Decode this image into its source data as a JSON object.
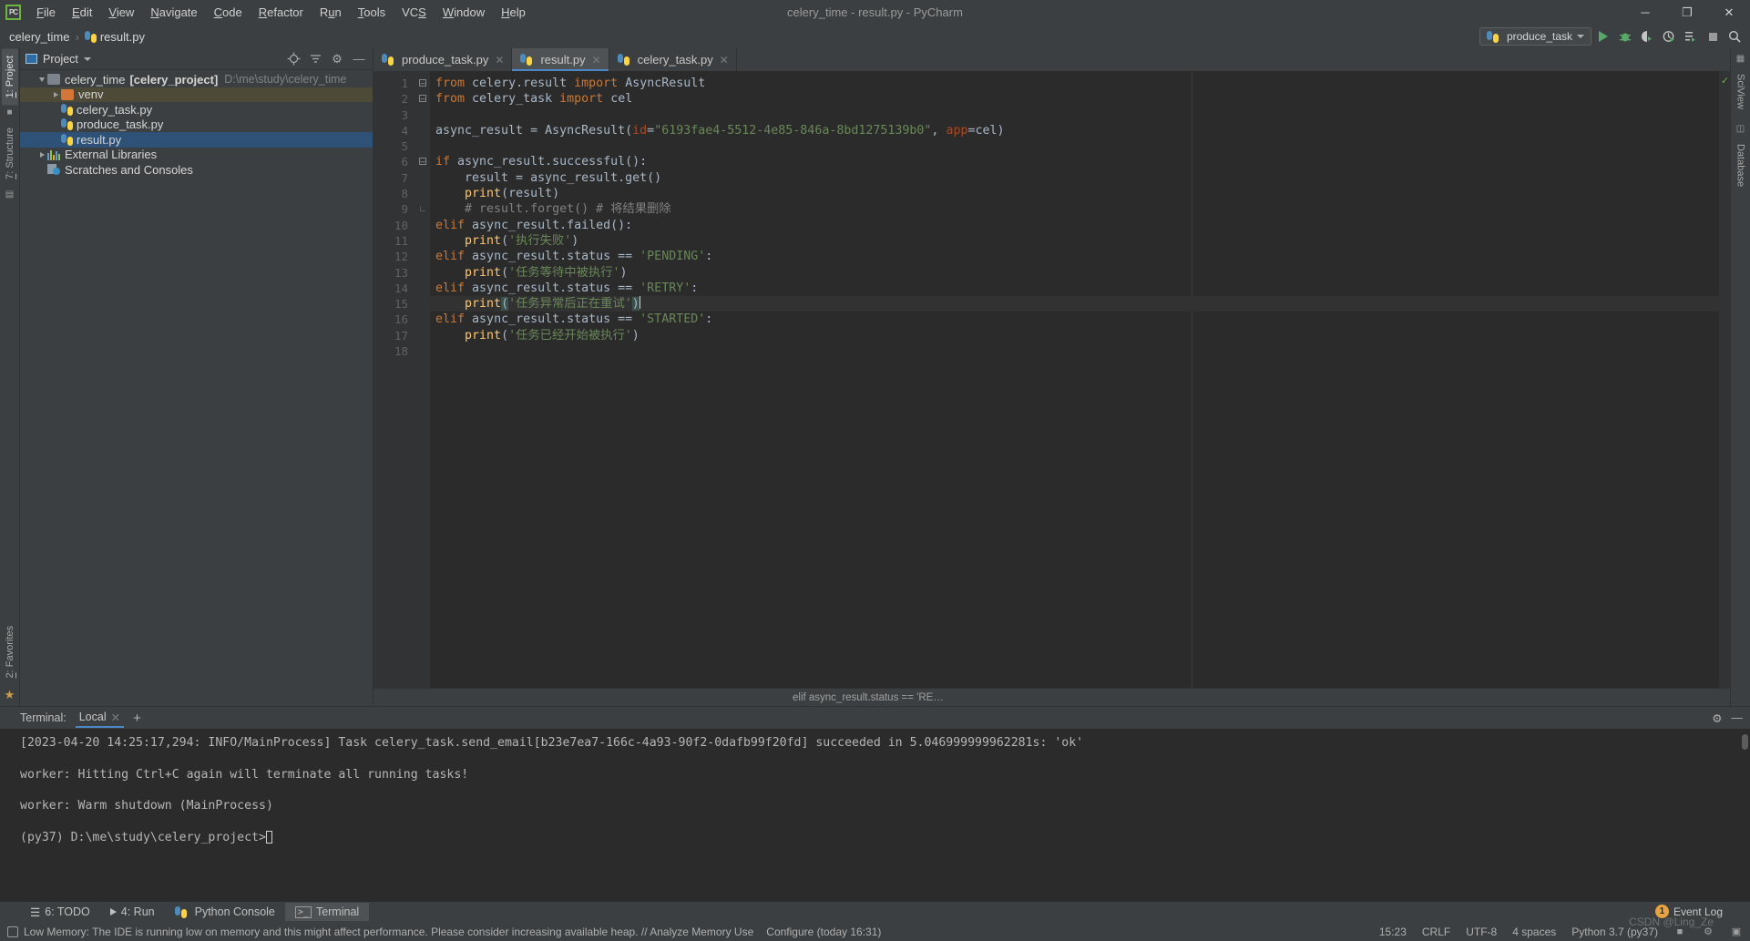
{
  "window": {
    "title": "celery_time - result.py - PyCharm",
    "logo": "pycharm-logo",
    "minimize": "─",
    "maximize": "❐",
    "close": "✕"
  },
  "menu": [
    {
      "label": "File"
    },
    {
      "label": "Edit"
    },
    {
      "label": "View"
    },
    {
      "label": "Navigate"
    },
    {
      "label": "Code"
    },
    {
      "label": "Refactor"
    },
    {
      "label": "Run"
    },
    {
      "label": "Tools"
    },
    {
      "label": "VCS"
    },
    {
      "label": "Window"
    },
    {
      "label": "Help"
    }
  ],
  "breadcrumb": {
    "project": "celery_time",
    "separator": "›",
    "file": "result.py"
  },
  "toolbar": {
    "run_config": "produce_task",
    "run": "run-button",
    "debug": "debug-button",
    "coverage": "run-with-coverage-button",
    "profile": "profile-button",
    "run_multiple": "run-multiple-button",
    "stop": "stop-button",
    "search": "search-everywhere-button"
  },
  "left_rail": {
    "top": [
      {
        "label": "1: Project",
        "active": true
      },
      {
        "label": "7: Structure",
        "active": false
      }
    ],
    "bottom": [
      {
        "label": "2: Favorites",
        "active": false
      }
    ]
  },
  "right_rail": [
    {
      "label": "SciView"
    },
    {
      "label": "Database"
    }
  ],
  "project_panel": {
    "title": "Project",
    "tree": [
      {
        "indent": 0,
        "twisty": "down",
        "icon": "folder",
        "label": "celery_time",
        "module": "[celery_project]",
        "path": "D:\\me\\study\\celery_time",
        "state": "normal"
      },
      {
        "indent": 1,
        "twisty": "right",
        "icon": "folder-orange",
        "label": "venv",
        "module": "",
        "path": "",
        "state": "highlight"
      },
      {
        "indent": 1,
        "twisty": "none",
        "icon": "python",
        "label": "celery_task.py",
        "module": "",
        "path": "",
        "state": "normal"
      },
      {
        "indent": 1,
        "twisty": "none",
        "icon": "python",
        "label": "produce_task.py",
        "module": "",
        "path": "",
        "state": "normal"
      },
      {
        "indent": 1,
        "twisty": "none",
        "icon": "python",
        "label": "result.py",
        "module": "",
        "path": "",
        "state": "selected"
      },
      {
        "indent": 0,
        "twisty": "right",
        "icon": "libraries",
        "label": "External Libraries",
        "module": "",
        "path": "",
        "state": "normal"
      },
      {
        "indent": 0,
        "twisty": "none",
        "icon": "scratches",
        "label": "Scratches and Consoles",
        "module": "",
        "path": "",
        "state": "normal"
      }
    ]
  },
  "editor": {
    "tabs": [
      {
        "label": "produce_task.py",
        "active": false,
        "close": "✕"
      },
      {
        "label": "result.py",
        "active": true,
        "close": "✕"
      },
      {
        "label": "celery_task.py",
        "active": false,
        "close": "✕"
      }
    ],
    "line_numbers": [
      "1",
      "2",
      "3",
      "4",
      "5",
      "6",
      "7",
      "8",
      "9",
      "10",
      "11",
      "12",
      "13",
      "14",
      "15",
      "16",
      "17",
      "18"
    ],
    "lines": [
      {
        "n": 1,
        "text": "from celery.result import AsyncResult"
      },
      {
        "n": 2,
        "text": "from celery_task import cel"
      },
      {
        "n": 3,
        "text": ""
      },
      {
        "n": 4,
        "text": "async_result = AsyncResult(id=\"6193fae4-5512-4e85-846a-8bd1275139b0\", app=cel)"
      },
      {
        "n": 5,
        "text": ""
      },
      {
        "n": 6,
        "text": "if async_result.successful():"
      },
      {
        "n": 7,
        "text": "    result = async_result.get()"
      },
      {
        "n": 8,
        "text": "    print(result)"
      },
      {
        "n": 9,
        "text": "    # result.forget() # 将结果删除"
      },
      {
        "n": 10,
        "text": "elif async_result.failed():"
      },
      {
        "n": 11,
        "text": "    print('执行失败')"
      },
      {
        "n": 12,
        "text": "elif async_result.status == 'PENDING':"
      },
      {
        "n": 13,
        "text": "    print('任务等待中被执行')"
      },
      {
        "n": 14,
        "text": "elif async_result.status == 'RETRY':"
      },
      {
        "n": 15,
        "text": "    print('任务异常后正在重试')"
      },
      {
        "n": 16,
        "text": "elif async_result.status == 'STARTED':"
      },
      {
        "n": 17,
        "text": "    print('任务已经开始被执行')"
      },
      {
        "n": 18,
        "text": ""
      }
    ],
    "uuid": "6193fae4-5512-4e85-846a-8bd1275139b0",
    "breadcrumb_hint": "elif async_result.status == 'RE…"
  },
  "terminal": {
    "label": "Terminal:",
    "tab": "Local",
    "tab_close": "✕",
    "new_tab": "+",
    "settings_icon": "gear-icon",
    "hide_icon": "hide-icon",
    "output": [
      "[2023-04-20 14:25:17,294: INFO/MainProcess] Task celery_task.send_email[b23e7ea7-166c-4a93-90f2-0dafb99f20fd] succeeded in 5.046999999962281s: 'ok'",
      "",
      "worker: Hitting Ctrl+C again will terminate all running tasks!",
      "",
      "worker: Warm shutdown (MainProcess)",
      "",
      "(py37) D:\\me\\study\\celery_project>"
    ]
  },
  "tool_tabs": [
    {
      "label": "6: TODO",
      "icon": "todo-icon",
      "active": false
    },
    {
      "label": "4: Run",
      "icon": "run-icon",
      "active": false
    },
    {
      "label": "Python Console",
      "icon": "python-icon",
      "active": false
    },
    {
      "label": "Terminal",
      "icon": "terminal-icon",
      "active": true
    }
  ],
  "status_bar": {
    "message": "Low Memory: The IDE is running low on memory and this might affect performance. Please consider increasing available heap. // Analyze Memory Use",
    "configure": "Configure (today 16:31)",
    "time": "15:23",
    "line_sep": "CRLF",
    "encoding": "UTF-8",
    "indent": "4 spaces",
    "interpreter": "Python 3.7 (py37)",
    "event_log": "Event Log",
    "event_count": "1",
    "watermark": "CSDN @Ling_Ze"
  },
  "colors": {
    "accent": "#4a88c7",
    "keyword": "#cc7832",
    "string": "#6a8759",
    "comment": "#808080",
    "selection": "#2d5177",
    "editor_bg": "#2b2b2b",
    "chrome_bg": "#3c3f41",
    "green": "#59a869",
    "badge": "#e8a33d"
  }
}
